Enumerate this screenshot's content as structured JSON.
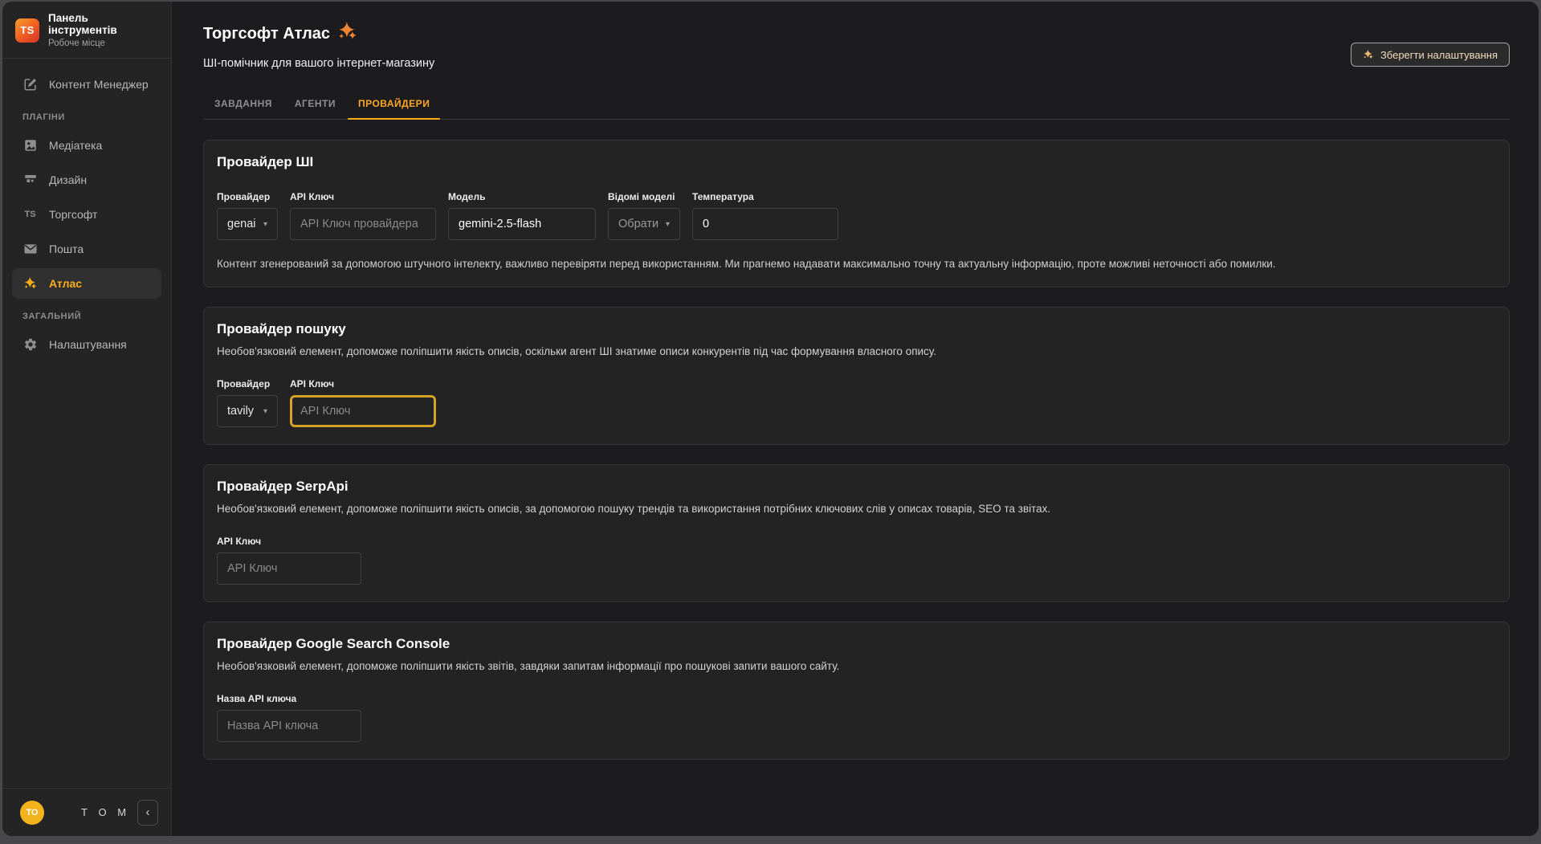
{
  "sidebar": {
    "brand": {
      "logo": "TS",
      "title": "Панель інструментів",
      "subtitle": "Робоче місце"
    },
    "items": [
      {
        "label": "Контент Менеджер"
      },
      {
        "label": "Медіатека"
      },
      {
        "label": "Дизайн"
      },
      {
        "label": "Торгсофт"
      },
      {
        "label": "Пошта"
      },
      {
        "label": "Атлас"
      },
      {
        "label": "Налаштування"
      }
    ],
    "sections": {
      "plugins": "ПЛАГІНИ",
      "general": "ЗАГАЛЬНИЙ"
    },
    "footer": {
      "initials": "ТО",
      "name": "Т О М"
    }
  },
  "header": {
    "title": "Торгсофт Атлас",
    "subtitle": "ШІ-помічник для вашого інтернет-магазину",
    "save_label": "Зберегти налаштування"
  },
  "tabs": {
    "tasks": "ЗАВДАННЯ",
    "agents": "АГЕНТИ",
    "providers": "ПРОВАЙДЕРИ"
  },
  "ai_card": {
    "title": "Провайдер ШІ",
    "provider_label": "Провайдер",
    "provider_value": "genai",
    "api_key_label": "API Ключ",
    "api_key_placeholder": "API Ключ провайдера",
    "model_label": "Модель",
    "model_value": "gemini-2.5-flash",
    "known_models_label": "Відомі моделі",
    "known_models_placeholder": "Обрати",
    "temperature_label": "Температура",
    "temperature_value": "0",
    "disclaimer": "Контент згенерований за допомогою штучного інтелекту, важливо перевіряти перед використанням. Ми прагнемо надавати максимально точну та актуальну інформацію, проте можливі неточності або помилки."
  },
  "search_card": {
    "title": "Провайдер пошуку",
    "description": "Необов'язковий елемент, допоможе поліпшити якість описів, оскільки агент ШІ знатиме описи конкурентів під час формування власного опису.",
    "provider_label": "Провайдер",
    "provider_value": "tavily",
    "api_key_label": "API Ключ",
    "api_key_placeholder": "API Ключ"
  },
  "serpapi_card": {
    "title": "Провайдер SerpApi",
    "description": "Необов'язковий елемент, допоможе поліпшити якість описів, за допомогою пошуку трендів та використання потрібних ключових слів у описах товарів, SEO та звітах.",
    "api_key_label": "API Ключ",
    "api_key_placeholder": "API Ключ"
  },
  "gsc_card": {
    "title": "Провайдер Google Search Console",
    "description": "Необов'язковий елемент, допоможе поліпшити якість звітів, завдяки запитам інформації про пошукові запити вашого сайту.",
    "key_name_label": "Назва API ключа",
    "key_name_placeholder": "Назва API ключа"
  },
  "colors": {
    "accent": "#ffa72b",
    "tab_underline": "#f9ae18",
    "focus_border": "#d5a325",
    "avatar_bg": "#f2b31c",
    "sparkle_orange": "#ef8433"
  }
}
